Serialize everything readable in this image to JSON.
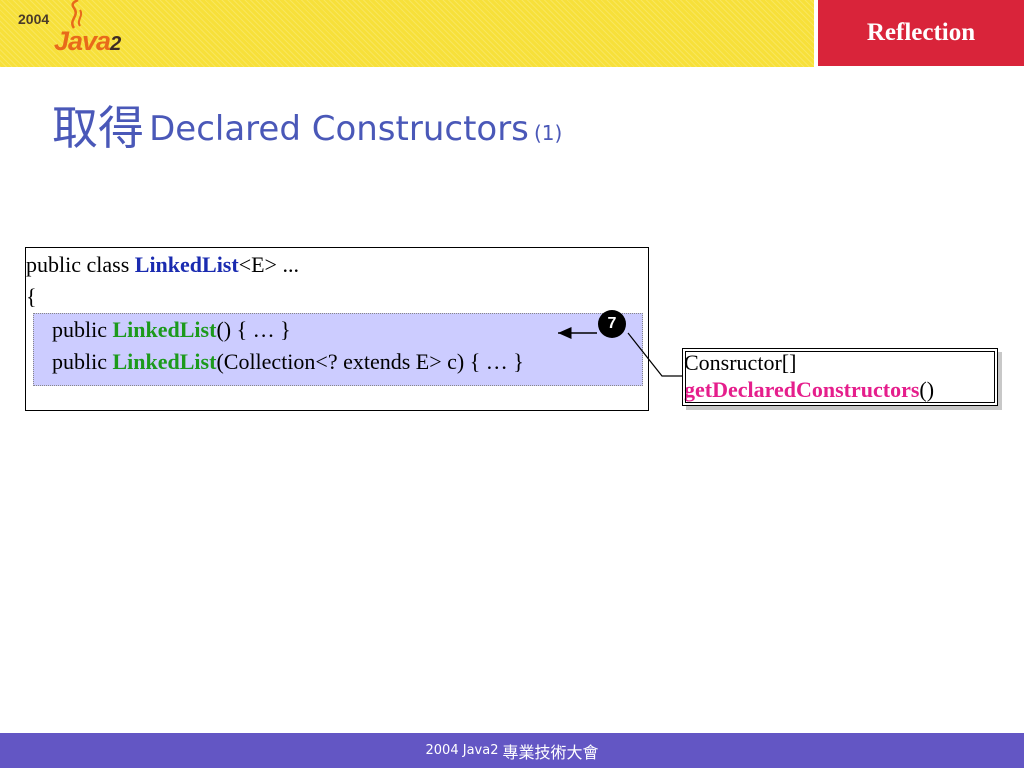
{
  "header": {
    "logo_year": "2004",
    "logo_java": "Java",
    "logo_two": "2",
    "section_tab": "Reflection",
    "brand_color": "#f7e03a",
    "tab_color": "#d9243a"
  },
  "slide": {
    "title_cjk": "取得",
    "title_main": "Declared Constructors",
    "title_num": "(1)"
  },
  "code": {
    "line1": {
      "pre": "public class ",
      "cls": "LinkedList",
      "post": "<E> ..."
    },
    "line2": "{",
    "line3": {
      "pre": "public ",
      "ctor": "LinkedList",
      "post": "() { … }"
    },
    "line4": {
      "pre": "public ",
      "ctor": "LinkedList",
      "post": "(Collection<? extends E> c) { … }"
    }
  },
  "callout": {
    "badge": "7",
    "type": "Consructor[]",
    "method": "getDeclaredConstructors",
    "parens": "()"
  },
  "footer": {
    "year_java": "2004 Java2",
    "event": "專業技術大會"
  }
}
